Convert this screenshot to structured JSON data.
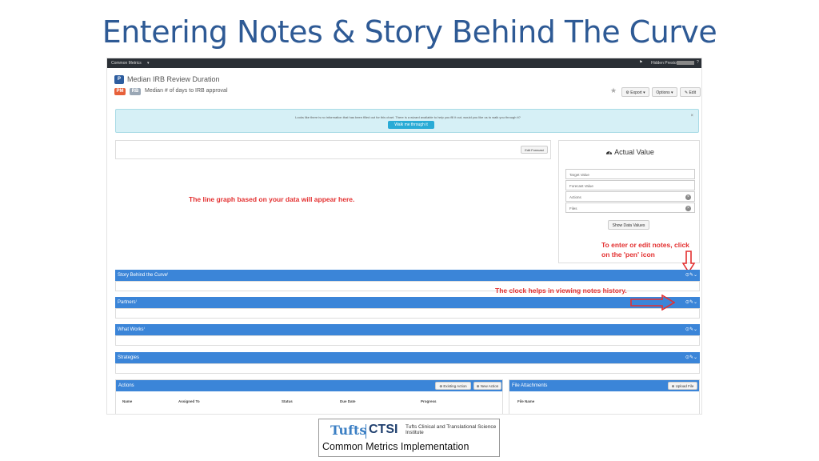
{
  "slide": {
    "title": "Entering Notes & Story Behind The Curve"
  },
  "topbar": {
    "menu": "Common Metrics",
    "caret": "▾",
    "flag": "⚑",
    "user": "Hidden Preston ▾",
    "help": "?"
  },
  "measure": {
    "badge_p": "P",
    "badge_pm": "PM",
    "badge_rb": "RB",
    "title": "Median IRB Review Duration",
    "subtitle": "Median # of days to IRB approval"
  },
  "toolbar": {
    "star": "★",
    "export": "⚙ Export ▾",
    "options": "Options ▾",
    "edit": "✎ Edit"
  },
  "alert": {
    "text": "Looks like there is no information that has been filled out for this chart. There is a wizard available to help you fill it out, would you like us to walk you through it?",
    "close": "×",
    "walk_button": "Walk me through it"
  },
  "graph": {
    "edit_forecast": "Edit Forecast",
    "placeholder_note": "The line graph based on your data will appear here."
  },
  "actual_value": {
    "icon": "speedometer-icon",
    "title": "Actual Value",
    "fields": {
      "target": "Target Value",
      "forecast": "Forecast Value",
      "actions": "Actions",
      "files": "Files"
    },
    "clear": "×",
    "show_button": "Show Data Values"
  },
  "annotations": {
    "pen": "To enter or edit notes, click on the 'pen' icon",
    "clock": "The clock helps in viewing notes history."
  },
  "sections": [
    {
      "label": "Story Behind the Curve"
    },
    {
      "label": "Partners"
    },
    {
      "label": "What Works"
    },
    {
      "label": "Strategies"
    }
  ],
  "section_icons": "⊙✎⌄",
  "actions_panel": {
    "title": "Actions",
    "existing_button": "⊕ Existing Action",
    "new_button": "⊕ New Action",
    "columns": [
      "Name",
      "Assigned To",
      "Status",
      "Due Date",
      "Progress"
    ]
  },
  "files_panel": {
    "title": "File Attachments",
    "upload_button": "⊕ Upload File",
    "columns": [
      "File Name"
    ]
  },
  "logo": {
    "tufts": "Tufts",
    "ctsi": "CTSI",
    "institute": "Tufts Clinical and Translational Science Institute",
    "program": "Common Metrics Implementation"
  },
  "colors": {
    "title_blue": "#2e5a95",
    "section_blue": "#3b85d8",
    "annotation_red": "#e33030",
    "alert_bg": "#d6f0f6"
  }
}
